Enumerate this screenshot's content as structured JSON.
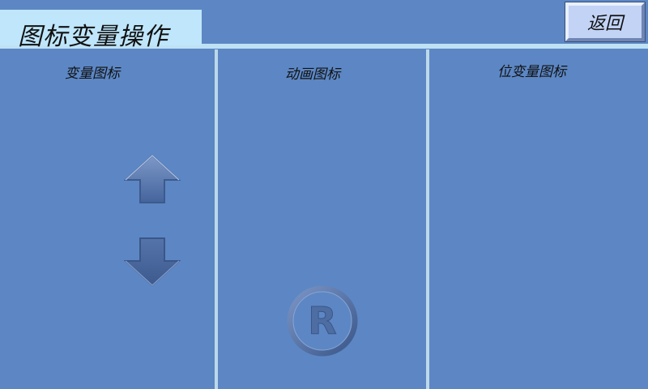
{
  "header": {
    "title": "图标变量操作",
    "back_label": "返回"
  },
  "panels": [
    {
      "label": "变量图标"
    },
    {
      "label": "动画图标"
    },
    {
      "label": "位变量图标"
    }
  ],
  "icons": {
    "arrow_up": "arrow-up-icon",
    "arrow_down": "arrow-down-icon",
    "registered": "registered-mark-icon",
    "registered_glyph": "R"
  },
  "colors": {
    "background": "#5c87c4",
    "title_background": "#bfe6fb",
    "button_face": "#c2d3f6",
    "divider": "#bcd8ea",
    "icon_fill": "#4f6ea4"
  }
}
